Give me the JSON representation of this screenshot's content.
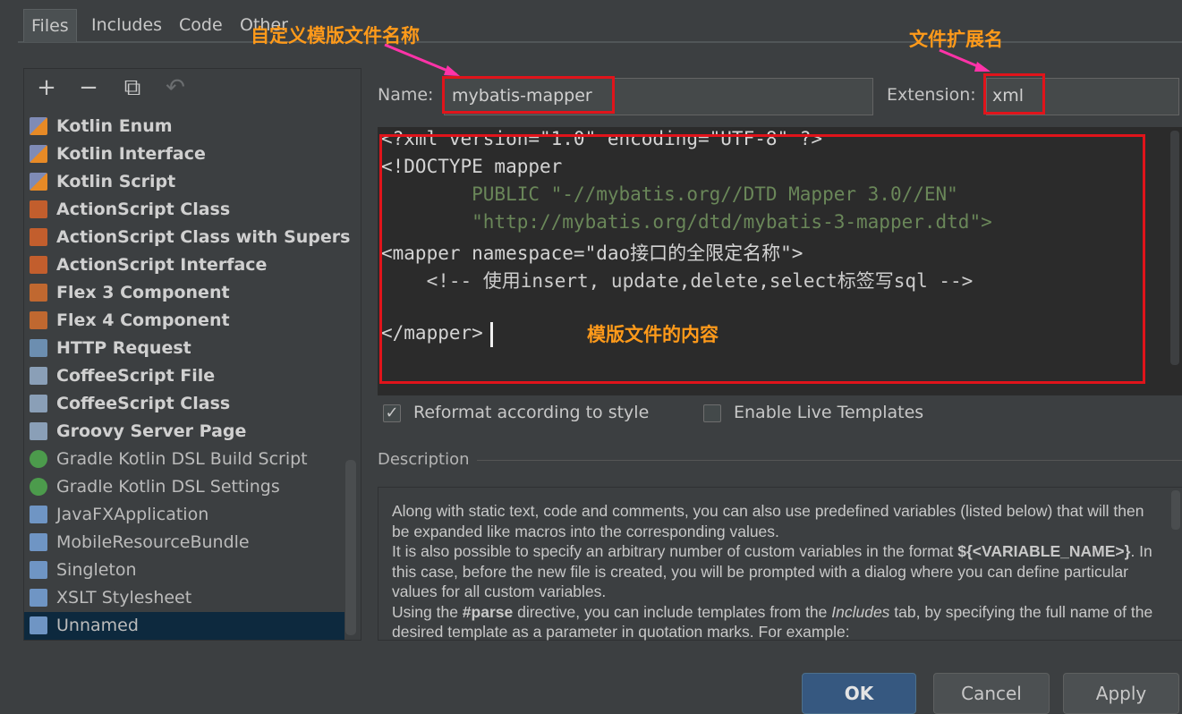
{
  "tabs": [
    "Files",
    "Includes",
    "Code",
    "Other"
  ],
  "toolbar": {
    "icons": [
      "plus-icon",
      "minus-icon",
      "copy-icon",
      "undo-icon"
    ],
    "glyphs": [
      "+",
      "−",
      "⧉",
      "↶"
    ]
  },
  "template_list": [
    {
      "label": "Kotlin Enum",
      "bold": true,
      "icon": "kotlin"
    },
    {
      "label": "Kotlin Interface",
      "bold": true,
      "icon": "kotlin"
    },
    {
      "label": "Kotlin Script",
      "bold": true,
      "icon": "kotlin"
    },
    {
      "label": "ActionScript Class",
      "bold": true,
      "icon": "as"
    },
    {
      "label": "ActionScript Class with Supers",
      "bold": true,
      "icon": "as"
    },
    {
      "label": "ActionScript Interface",
      "bold": true,
      "icon": "as"
    },
    {
      "label": "Flex 3 Component",
      "bold": true,
      "icon": "flex"
    },
    {
      "label": "Flex 4 Component",
      "bold": true,
      "icon": "flex"
    },
    {
      "label": "HTTP Request",
      "bold": true,
      "icon": "http"
    },
    {
      "label": "CoffeeScript File",
      "bold": true,
      "icon": "coffee"
    },
    {
      "label": "CoffeeScript Class",
      "bold": true,
      "icon": "coffee"
    },
    {
      "label": "Groovy Server Page",
      "bold": true,
      "icon": "groovy"
    },
    {
      "label": "Gradle Kotlin DSL Build Script",
      "bold": false,
      "icon": "gradle"
    },
    {
      "label": "Gradle Kotlin DSL Settings",
      "bold": false,
      "icon": "gradle"
    },
    {
      "label": "JavaFXApplication",
      "bold": false,
      "icon": "java"
    },
    {
      "label": "MobileResourceBundle",
      "bold": false,
      "icon": "java"
    },
    {
      "label": "Singleton",
      "bold": false,
      "icon": "java"
    },
    {
      "label": "XSLT Stylesheet",
      "bold": false,
      "icon": "java"
    },
    {
      "label": "Unnamed",
      "bold": false,
      "icon": "java",
      "selected": true
    }
  ],
  "form": {
    "name_label": "Name:",
    "name_value": "mybatis-mapper",
    "extension_label": "Extension:",
    "extension_value": "xml"
  },
  "editor": {
    "lines": [
      "<?xml version=\"1.0\" encoding=\"UTF-8\" ?>",
      "<!DOCTYPE mapper",
      "        PUBLIC \"-//mybatis.org//DTD Mapper 3.0//EN\"",
      "        \"http://mybatis.org/dtd/mybatis-3-mapper.dtd\">",
      "<mapper namespace=\"dao接口的全限定名称\">",
      "    <!-- 使用insert, update,delete,select标签写sql -->",
      "",
      "</mapper>"
    ]
  },
  "options": {
    "reformat_label": "Reformat according to style",
    "reformat_checked": true,
    "live_templates_label": "Enable Live Templates",
    "live_templates_checked": false
  },
  "description": {
    "title": "Description",
    "p1": "Along with static text, code and comments, you can also use predefined variables (listed below) that will then be expanded like macros into the corresponding values.",
    "p2a": "It is also possible to specify an arbitrary number of custom variables in the format ",
    "p2_code": "${<VARIABLE_NAME>}",
    "p2b": ". In this case, before the new file is created, you will be prompted with a dialog where you can define particular values for all custom variables.",
    "p3a": "Using the ",
    "p3_code": "#parse",
    "p3b": " directive, you can include templates from the ",
    "p3_em": "Includes",
    "p3c": " tab, by specifying the full name of the desired template as a parameter in quotation marks. For example:"
  },
  "buttons": {
    "ok": "OK",
    "cancel": "Cancel",
    "apply": "Apply"
  },
  "annotations": {
    "name_note": "自定义模版文件名称",
    "ext_note": "文件扩展名",
    "content_note": "模版文件的内容"
  }
}
